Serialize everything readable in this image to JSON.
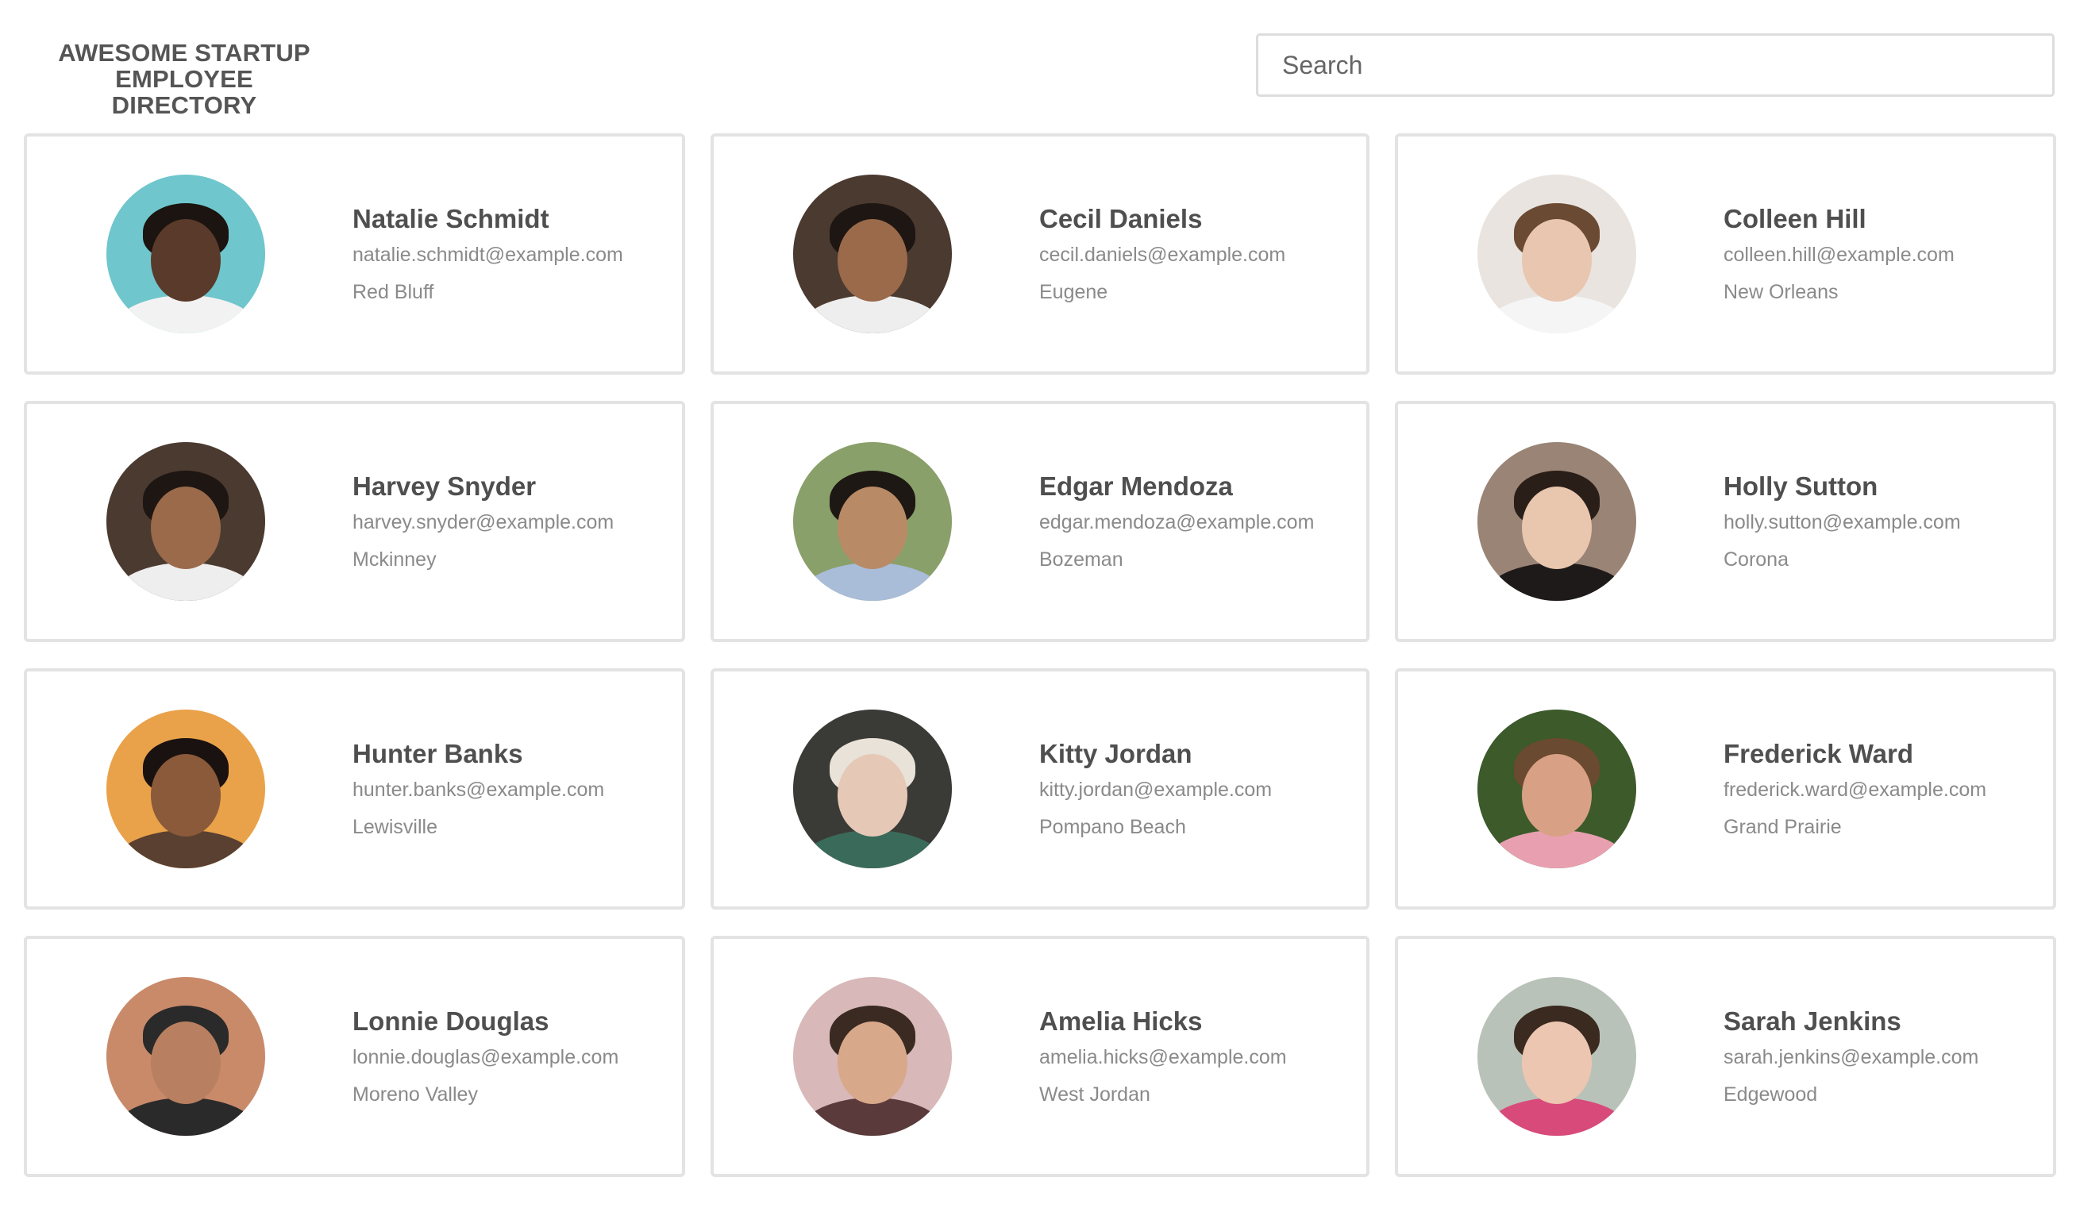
{
  "header": {
    "title_line1": "AWESOME STARTUP",
    "title_line2": "EMPLOYEE DIRECTORY",
    "search_placeholder": "Search"
  },
  "employees": [
    {
      "name": "Natalie Schmidt",
      "email": "natalie.schmidt@example.com",
      "city": "Red Bluff",
      "avatar": {
        "bg": "#6fc6cc",
        "skin": "#5a3a2a",
        "hair": "#1c1410",
        "shirt": "#f2f2f2"
      }
    },
    {
      "name": "Cecil Daniels",
      "email": "cecil.daniels@example.com",
      "city": "Eugene",
      "avatar": {
        "bg": "#4b3a30",
        "skin": "#9a6a4a",
        "hair": "#1e1612",
        "shirt": "#eeeeee"
      }
    },
    {
      "name": "Colleen Hill",
      "email": "colleen.hill@example.com",
      "city": "New Orleans",
      "avatar": {
        "bg": "#e9e4df",
        "skin": "#e8c6b0",
        "hair": "#6b4a33",
        "shirt": "#f5f5f5"
      }
    },
    {
      "name": "Harvey Snyder",
      "email": "harvey.snyder@example.com",
      "city": "Mckinney",
      "avatar": {
        "bg": "#4b3a30",
        "skin": "#9a6a4a",
        "hair": "#1e1612",
        "shirt": "#eeeeee"
      }
    },
    {
      "name": "Edgar Mendoza",
      "email": "edgar.mendoza@example.com",
      "city": "Bozeman",
      "avatar": {
        "bg": "#8aa06a",
        "skin": "#b98a66",
        "hair": "#1e1814",
        "shirt": "#a9bcd8"
      }
    },
    {
      "name": "Holly Sutton",
      "email": "holly.sutton@example.com",
      "city": "Corona",
      "avatar": {
        "bg": "#9a8476",
        "skin": "#e9c6ae",
        "hair": "#2a1e18",
        "shirt": "#1e1a1a"
      }
    },
    {
      "name": "Hunter Banks",
      "email": "hunter.banks@example.com",
      "city": "Lewisville",
      "avatar": {
        "bg": "#e9a24a",
        "skin": "#8a5a3a",
        "hair": "#1a1210",
        "shirt": "#5a4030"
      }
    },
    {
      "name": "Kitty Jordan",
      "email": "kitty.jordan@example.com",
      "city": "Pompano Beach",
      "avatar": {
        "bg": "#3a3a36",
        "skin": "#e6c8b6",
        "hair": "#e8e2d8",
        "shirt": "#3a6a5a"
      }
    },
    {
      "name": "Frederick Ward",
      "email": "frederick.ward@example.com",
      "city": "Grand Prairie",
      "avatar": {
        "bg": "#3c5a2a",
        "skin": "#d8a084",
        "hair": "#6a4a30",
        "shirt": "#e8a0b0"
      }
    },
    {
      "name": "Lonnie Douglas",
      "email": "lonnie.douglas@example.com",
      "city": "Moreno Valley",
      "avatar": {
        "bg": "#c98a6a",
        "skin": "#b88060",
        "hair": "#2a2a2a",
        "shirt": "#2a2a2a"
      }
    },
    {
      "name": "Amelia Hicks",
      "email": "amelia.hicks@example.com",
      "city": "West Jordan",
      "avatar": {
        "bg": "#d8b8b8",
        "skin": "#d8a88a",
        "hair": "#3a2a22",
        "shirt": "#5a3a3a"
      }
    },
    {
      "name": "Sarah Jenkins",
      "email": "sarah.jenkins@example.com",
      "city": "Edgewood",
      "avatar": {
        "bg": "#b9c2b8",
        "skin": "#ecc6b0",
        "hair": "#3a2a20",
        "shirt": "#d84a7a"
      }
    }
  ]
}
